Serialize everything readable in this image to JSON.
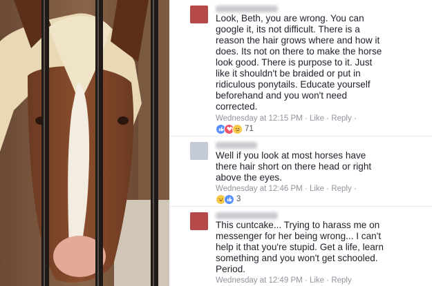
{
  "comments": [
    {
      "author_blurred": "Caroline Gibson",
      "text": "Look, Beth, you are wrong. You can\ngoogle it, its not difficult. There is a\nreason the hair grows where and how it\ndoes. Its not on there to make the horse\nlook good. There is purpose to it. Just\nlike it shouldn't be braided or put in\nridiculous ponytails. Educate yourself\nbeforehand and you won't need\ncorrected.",
      "timestamp": "Wednesday at 12:15 PM",
      "like_label": "Like",
      "reply_label": "Reply",
      "reaction_icons": [
        "like-icon",
        "love-icon",
        "sad-icon"
      ],
      "reaction_count": "71"
    },
    {
      "author_blurred": "Beth Hardy",
      "text": "Well if you look at most horses have\nthere hair short on there head or right\nabove the eyes.",
      "timestamp": "Wednesday at 12:46 PM",
      "like_label": "Like",
      "reply_label": "Reply",
      "reaction_icons": [
        "haha-icon",
        "like-icon"
      ],
      "reaction_count": "3"
    },
    {
      "author_blurred": "Caroline Gibson",
      "text": "This cuntcake... Trying to harass me on\nmessenger for her being wrong... I can't\nhelp it that you're stupid. Get a life, learn\nsomething and you won't get schooled.\nPeriod.",
      "timestamp": "Wednesday at 12:49 PM",
      "like_label": "Like",
      "reply_label": "Reply"
    }
  ],
  "separator": " · ",
  "colors": {
    "text": "#1d2129",
    "meta": "#90949c",
    "like_blue": "#5890ff",
    "love_red": "#f25268",
    "emoji_yellow": "#f7c948"
  }
}
